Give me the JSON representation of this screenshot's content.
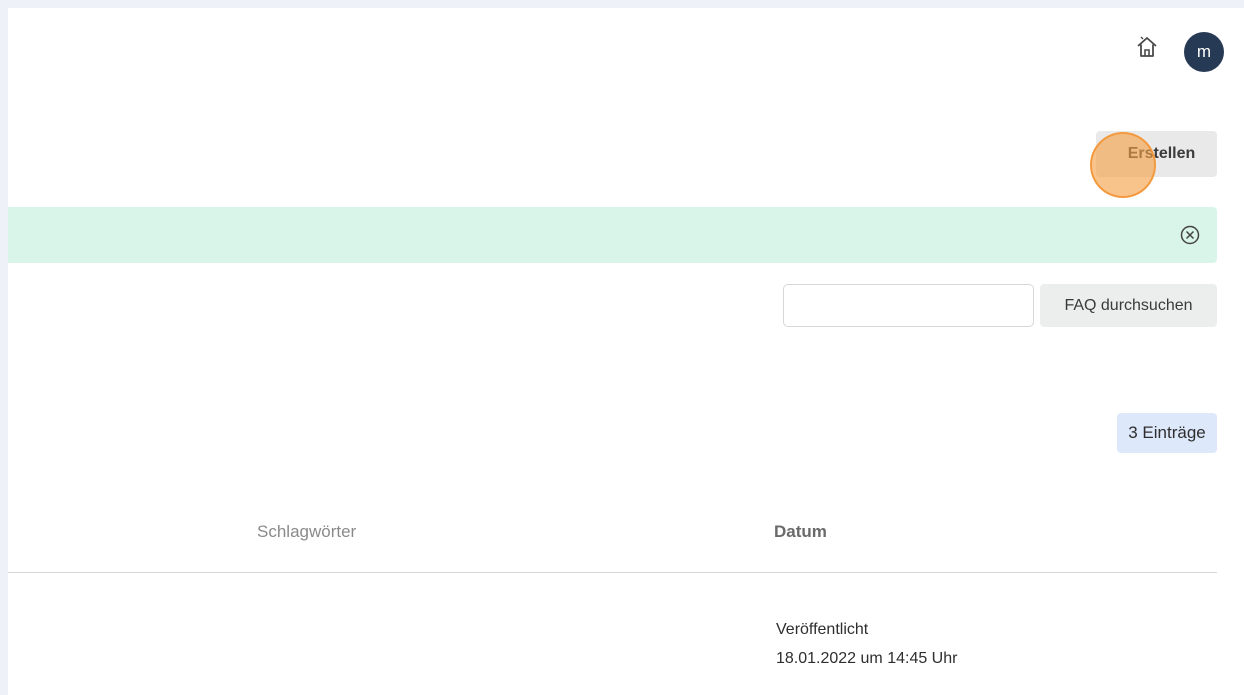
{
  "header": {
    "home_icon": "home-icon",
    "avatar_initial": "m",
    "avatar_color": "#273a55"
  },
  "toolbar": {
    "create_label": "Erstellen"
  },
  "alert": {
    "color": "#d9f4e8",
    "close_icon": "circle-x-icon"
  },
  "search": {
    "value": "",
    "placeholder": "",
    "button_label": "FAQ durchsuchen"
  },
  "results": {
    "count_label": "3 Einträge"
  },
  "table": {
    "columns": [
      "Schlagwörter",
      "Datum"
    ],
    "rows": [
      {
        "status": "Veröffentlicht",
        "date": "18.01.2022 um 14:45 Uhr"
      }
    ]
  }
}
